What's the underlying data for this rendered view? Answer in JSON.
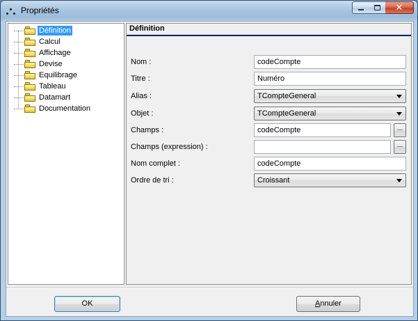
{
  "window": {
    "title": "Propriétés"
  },
  "tree": {
    "items": [
      {
        "label": "Définition",
        "selected": true
      },
      {
        "label": "Calcul",
        "selected": false
      },
      {
        "label": "Affichage",
        "selected": false
      },
      {
        "label": "Devise",
        "selected": false
      },
      {
        "label": "Equilibrage",
        "selected": false
      },
      {
        "label": "Tableau",
        "selected": false
      },
      {
        "label": "Datamart",
        "selected": false
      },
      {
        "label": "Documentation",
        "selected": false
      }
    ]
  },
  "panel": {
    "header": "Définition",
    "fields": {
      "nom": {
        "label": "Nom :",
        "value": "codeCompte"
      },
      "titre": {
        "label": "Titre :",
        "value": "Numéro"
      },
      "alias": {
        "label": "Alias :",
        "value": "TCompteGeneral"
      },
      "objet": {
        "label": "Objet :",
        "value": "TCompteGeneral"
      },
      "champs": {
        "label": "Champs :",
        "value": "codeCompte"
      },
      "champs_expr": {
        "label": "Champs (expression) :",
        "value": ""
      },
      "nom_complet": {
        "label": "Nom complet :",
        "value": "codeCompte"
      },
      "ordre_tri": {
        "label": "Ordre de tri :",
        "value": "Croissant"
      }
    },
    "ellipsis_label": "..."
  },
  "buttons": {
    "ok_label": "OK",
    "cancel_first": "A",
    "cancel_rest": "nnuler"
  }
}
